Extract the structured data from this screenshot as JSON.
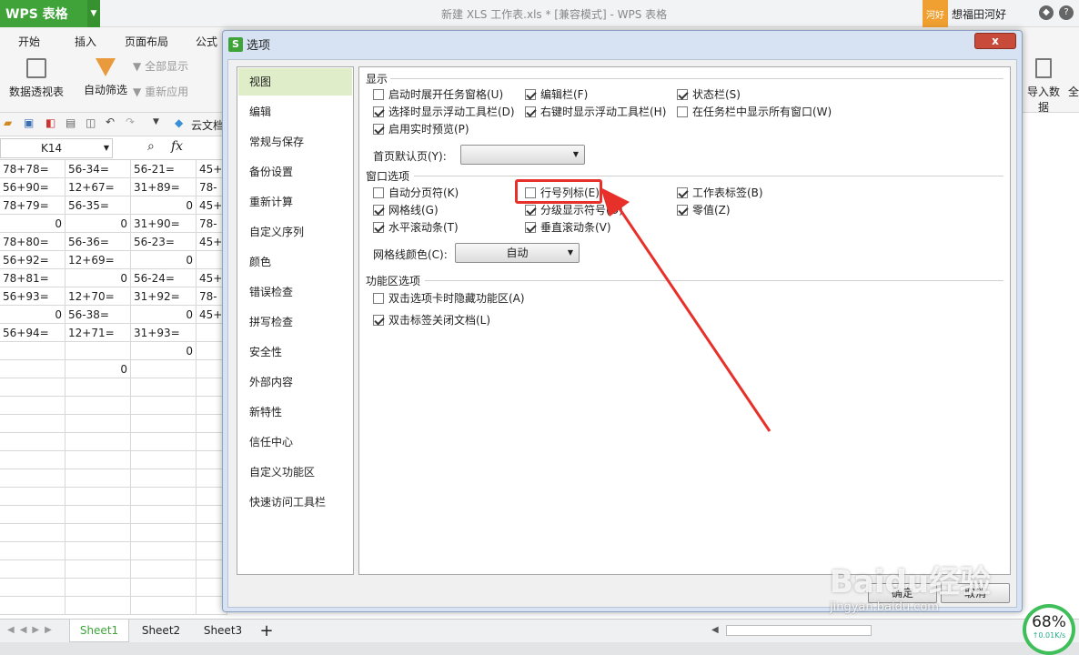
{
  "app": {
    "logo": "WPS 表格",
    "window_title": "新建 XLS 工作表.xls * [兼容模式] - WPS 表格",
    "badge": "河好",
    "user": "想福田河好"
  },
  "menu_tabs": [
    "开始",
    "插入",
    "页面布局",
    "公式"
  ],
  "ribbon": {
    "pivot": "数据透视表",
    "autofilter": "自动筛选",
    "show_all": "全部显示",
    "reapply": "重新应用",
    "import": "导入数据",
    "right_partial": "全"
  },
  "quickbar": {
    "cloud": "云文档"
  },
  "formula_bar": {
    "cell_ref": "K14",
    "fx": "fx"
  },
  "grid": {
    "rows": [
      [
        "78+78=",
        "56-34=",
        "56-21=",
        "45+"
      ],
      [
        "56+90=",
        "12+67=",
        "31+89=",
        "78-"
      ],
      [
        "78+79=",
        "56-35=",
        "0",
        "45+"
      ],
      [
        "0",
        "0",
        "31+90=",
        "78-"
      ],
      [
        "78+80=",
        "56-36=",
        "56-23=",
        "45+"
      ],
      [
        "56+92=",
        "12+69=",
        "0",
        ""
      ],
      [
        "78+81=",
        "0",
        "56-24=",
        "45+"
      ],
      [
        "56+93=",
        "12+70=",
        "31+92=",
        "78-"
      ],
      [
        "0",
        "56-38=",
        "0",
        "45+"
      ],
      [
        "56+94=",
        "12+71=",
        "31+93=",
        ""
      ],
      [
        "",
        "",
        "0",
        ""
      ],
      [
        "",
        "0",
        "",
        ""
      ]
    ]
  },
  "sheets": [
    "Sheet1",
    "Sheet2",
    "Sheet3"
  ],
  "add_sheet": "+",
  "dialog": {
    "title": "选项",
    "close": "x",
    "categories": [
      "视图",
      "编辑",
      "常规与保存",
      "备份设置",
      "重新计算",
      "自定义序列",
      "颜色",
      "错误检查",
      "拼写检查",
      "安全性",
      "外部内容",
      "新特性",
      "信任中心",
      "自定义功能区",
      "快速访问工具栏"
    ],
    "display_section": "显示",
    "display": [
      {
        "label": "启动时展开任务窗格(U)",
        "checked": false
      },
      {
        "label": "编辑栏(F)",
        "checked": true
      },
      {
        "label": "状态栏(S)",
        "checked": true
      },
      {
        "label": "选择时显示浮动工具栏(D)",
        "checked": true
      },
      {
        "label": "右键时显示浮动工具栏(H)",
        "checked": true
      },
      {
        "label": "在任务栏中显示所有窗口(W)",
        "checked": false
      },
      {
        "label": "启用实时预览(P)",
        "checked": true
      }
    ],
    "home_label": "首页默认页(Y):",
    "home_value": "",
    "window_section": "窗口选项",
    "window": [
      {
        "label": "自动分页符(K)",
        "checked": false
      },
      {
        "label": "行号列标(E)",
        "checked": false
      },
      {
        "label": "工作表标签(B)",
        "checked": true
      },
      {
        "label": "网格线(G)",
        "checked": true
      },
      {
        "label": "分级显示符号(O)",
        "checked": true
      },
      {
        "label": "零值(Z)",
        "checked": true
      },
      {
        "label": "水平滚动条(T)",
        "checked": true
      },
      {
        "label": "垂直滚动条(V)",
        "checked": true
      }
    ],
    "grid_color_label": "网格线颜色(C):",
    "grid_color_value": "自动",
    "ribbon_section": "功能区选项",
    "ribbon_opts": [
      {
        "label": "双击选项卡时隐藏功能区(A)",
        "checked": false
      },
      {
        "label": "双击标签关闭文档(L)",
        "checked": true
      }
    ],
    "ok": "确定",
    "cancel": "取消"
  },
  "net": {
    "percent": "68%",
    "speed": "↑0.01K/s"
  },
  "watermark": {
    "brand": "Baidu经验",
    "url": "jingyan.baidu.com"
  },
  "colors": {
    "accent": "#3fa33a",
    "highlight": "#e8302a",
    "selected_cat": "#dfeec8"
  }
}
